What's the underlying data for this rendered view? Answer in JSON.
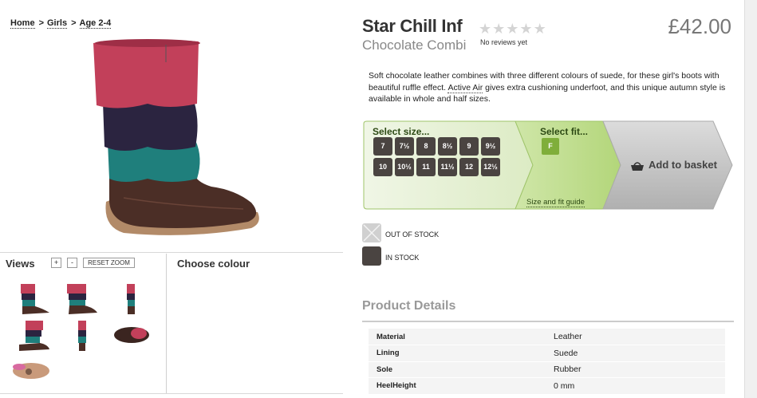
{
  "breadcrumb": {
    "items": [
      "Home",
      "Girls",
      "Age 2-4"
    ],
    "separator": ">"
  },
  "product": {
    "name": "Star Chill Inf",
    "colour": "Chocolate Combi",
    "price": "£42.00",
    "reviews_text": "No reviews yet",
    "rating_stars": 0,
    "rating_max": 5,
    "description_before": "Soft chocolate leather combines with three different colours of suede, for these girl's boots with beautiful ruffle effect. ",
    "description_link": "Active Air",
    "description_after": " gives extra cushioning underfoot, and this unique autumn style is available in whole and half sizes."
  },
  "views": {
    "label": "Views",
    "zoom_in": "+",
    "zoom_out": "-",
    "reset_zoom": "RESET ZOOM",
    "thumbnails": [
      "side-view",
      "front-view",
      "back-view",
      "three-quarter-view",
      "narrow-front-view",
      "top-view",
      "sole-view"
    ]
  },
  "choose_colour": {
    "label": "Choose colour"
  },
  "selector": {
    "size_label": "Select size...",
    "sizes_row1": [
      "7",
      "7½",
      "8",
      "8½",
      "9",
      "9½"
    ],
    "sizes_row2": [
      "10",
      "10½",
      "11",
      "11½",
      "12",
      "12½"
    ],
    "fit_label": "Select fit...",
    "fits": [
      "F"
    ],
    "fit_guide": "Size and fit guide",
    "add_to_basket": "Add to basket"
  },
  "stock_legend": {
    "out_of_stock": "OUT OF STOCK",
    "in_stock": "IN STOCK"
  },
  "product_details": {
    "title": "Product Details",
    "rows": [
      {
        "key": "Material",
        "value": "Leather"
      },
      {
        "key": "Lining",
        "value": "Suede"
      },
      {
        "key": "Sole",
        "value": "Rubber"
      },
      {
        "key": "HeelHeight",
        "value": "0 mm"
      }
    ]
  },
  "colors": {
    "size_button": "#4a4441",
    "fit_button": "#7fae3a",
    "selector_green_light": "#e8f2d8",
    "selector_green": "#c6df9e",
    "basket_grey": "#c4c4c4",
    "boot_pink": "#c2405a",
    "boot_navy": "#2b2440",
    "boot_teal": "#1f7f7c",
    "boot_brown": "#4b2e26"
  }
}
